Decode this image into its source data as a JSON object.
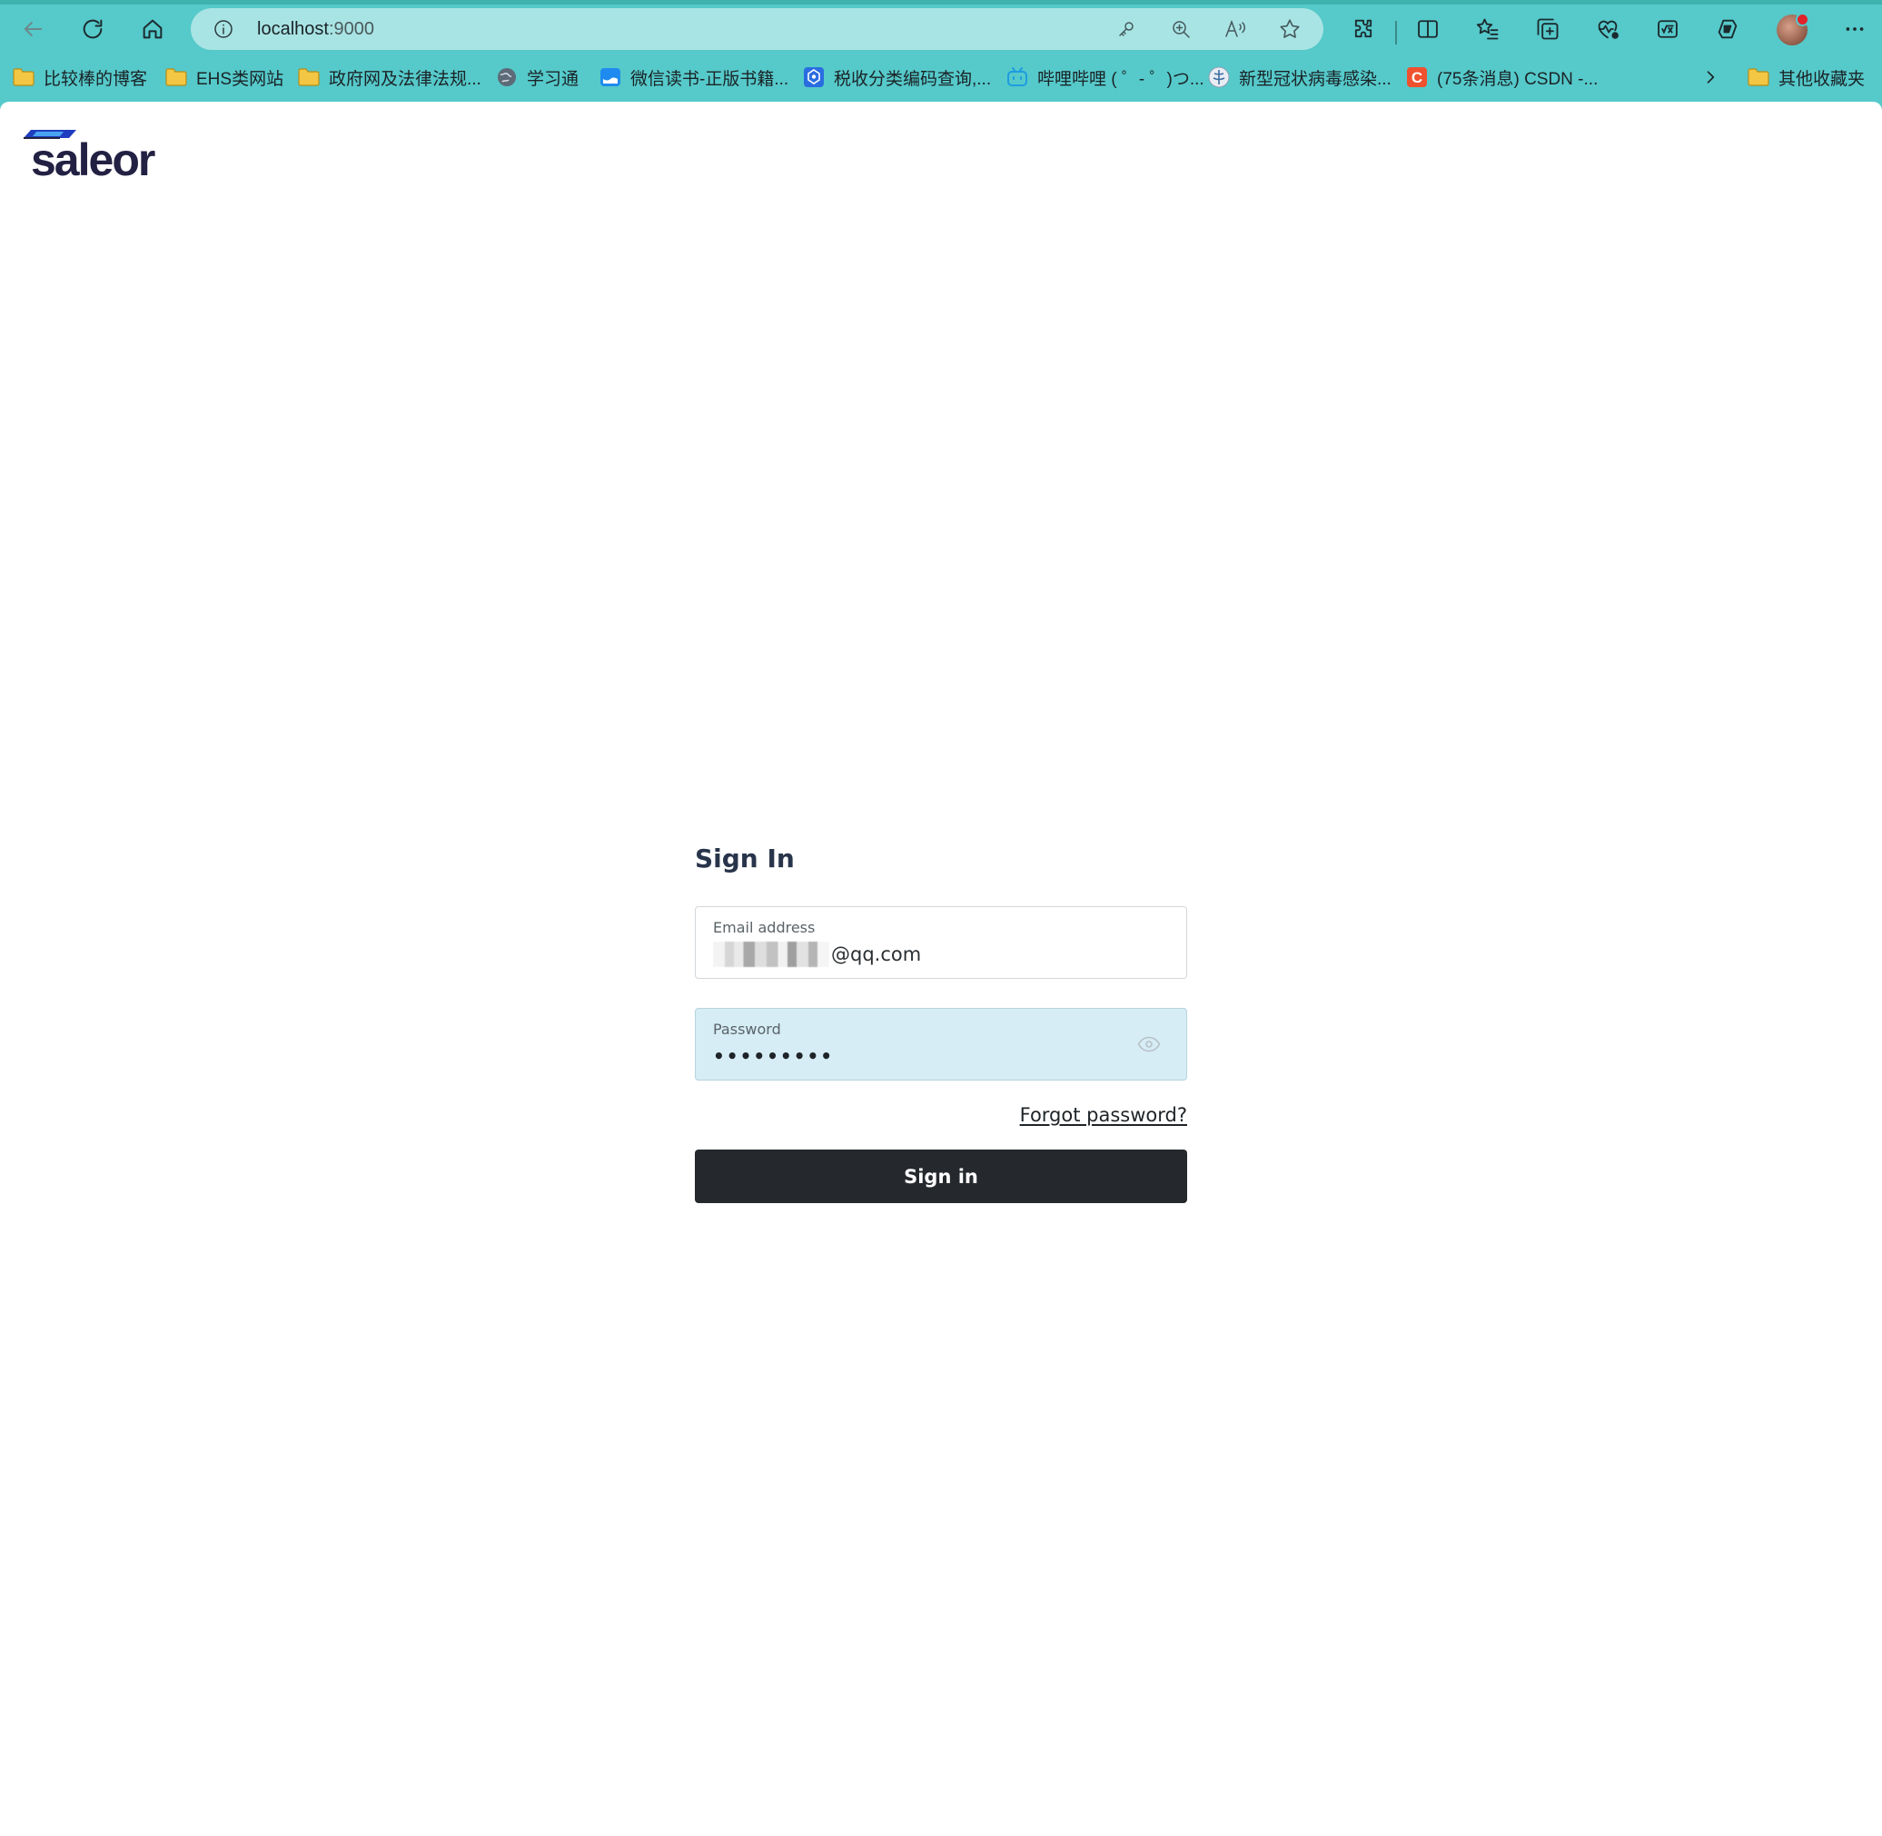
{
  "browser": {
    "address": {
      "host": "localhost",
      "port": ":9000"
    },
    "toolbar_icons": [
      "back-arrow-icon",
      "refresh-icon",
      "home-icon",
      "info-icon",
      "key-icon",
      "zoom-icon",
      "read-aloud-icon",
      "favorite-star-icon",
      "extensions-icon",
      "split-screen-icon",
      "favorites-icon",
      "collections-icon",
      "browser-essentials-icon",
      "math-solver-icon",
      "copilot-icon",
      "profile-avatar",
      "more-menu-icon"
    ],
    "bookmarks": [
      {
        "label": "比较棒的博客",
        "icon": "folder-icon"
      },
      {
        "label": "EHS类网站",
        "icon": "folder-icon"
      },
      {
        "label": "政府网及法律法规...",
        "icon": "folder-icon"
      },
      {
        "label": "学习通",
        "icon": "globe-icon"
      },
      {
        "label": "微信读书-正版书籍...",
        "icon": "weread-icon"
      },
      {
        "label": "税收分类编码查询,...",
        "icon": "tax-icon"
      },
      {
        "label": "哔哩哔哩 ( ゜- ゜)つ...",
        "icon": "bilibili-icon"
      },
      {
        "label": "新型冠状病毒感染...",
        "icon": "who-icon"
      },
      {
        "label": "(75条消息) CSDN -...",
        "icon": "csdn-icon"
      }
    ],
    "other_bookmarks": "其他收藏夹",
    "colors": {
      "chrome": "#56c9ca",
      "address_bar": "#a9e4e4"
    }
  },
  "app": {
    "logo_text": "saleor",
    "signin": {
      "title": "Sign In",
      "email": {
        "label": "Email address",
        "value": "@qq.com"
      },
      "password": {
        "label": "Password",
        "value": "•••••••••"
      },
      "forgot_link": "Forgot password?",
      "submit_label": "Sign in"
    },
    "colors": {
      "brand": "#222143",
      "button": "#25292d",
      "focused_field": "#d6edf6"
    }
  }
}
